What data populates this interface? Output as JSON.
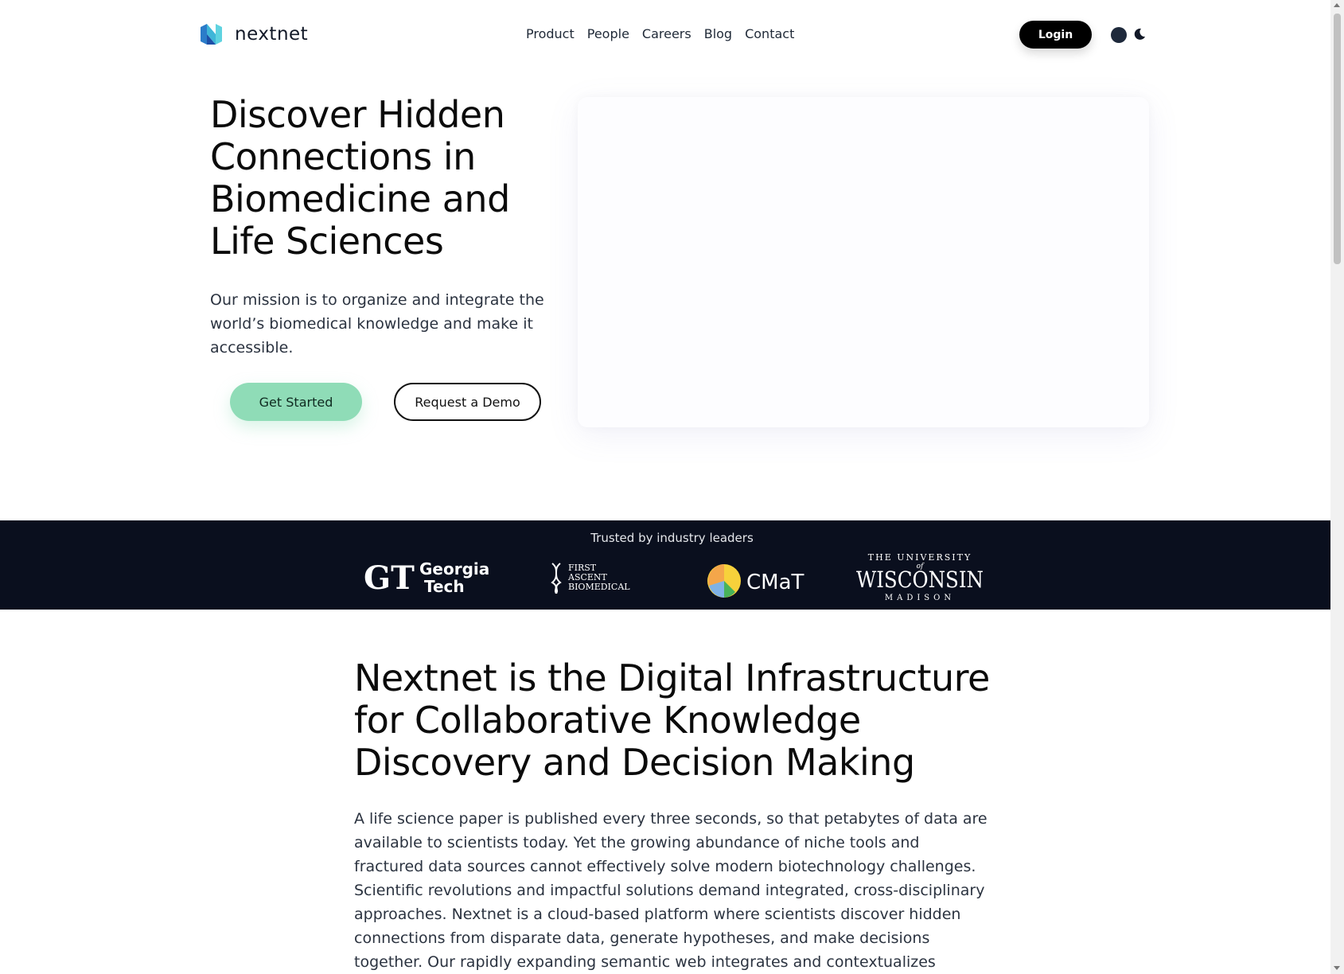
{
  "header": {
    "logo_text": "nextnet",
    "nav": [
      "Product",
      "People",
      "Careers",
      "Blog",
      "Contact"
    ],
    "login_label": "Login"
  },
  "hero": {
    "title": "Discover Hidden Connections in Biomedicine and Life Sciences",
    "subtitle": "Our mission is to organize and integrate the world’s biomedical knowledge and make it accessible.",
    "primary_cta": "Get Started",
    "secondary_cta": "Request a Demo"
  },
  "trusted": {
    "title": "Trusted by industry leaders",
    "partners": {
      "gt_line1": "Georgia",
      "gt_line2": "Tech",
      "fab_line1": "FIRST",
      "fab_line2": "ASCENT",
      "fab_line3": "BIOMEDICAL",
      "cmat": "CMaT",
      "uw_top": "THE UNIVERSITY",
      "uw_of": "of",
      "uw_main": "WISCONSIN",
      "uw_bottom": "MADISON"
    }
  },
  "section": {
    "title": "Nextnet is the Digital Infrastructure for Collaborative Knowledge Discovery and Decision Making",
    "body": "A life science paper is published every three seconds, so that petabytes of data are available to scientists today. Yet the growing abundance of niche tools and fractured data sources cannot effectively solve modern biotechnology challenges. Scientific revolutions and impactful solutions demand integrated, cross-disciplinary approaches. Nextnet is a cloud-based platform where scientists discover hidden connections from disparate data, generate hypotheses, and make decisions together. Our rapidly expanding semantic web integrates and contextualizes knowledge from a vast corpus of"
  },
  "colors": {
    "accent_green": "#8fdcb7",
    "band_bg": "#0a0f1e",
    "logo_teal": "#2bb3c9",
    "logo_blue": "#3b5bdb"
  },
  "icons": {
    "logo": "nextnet-logo-icon",
    "theme": "theme-dot-icon",
    "moon": "moon-icon"
  }
}
